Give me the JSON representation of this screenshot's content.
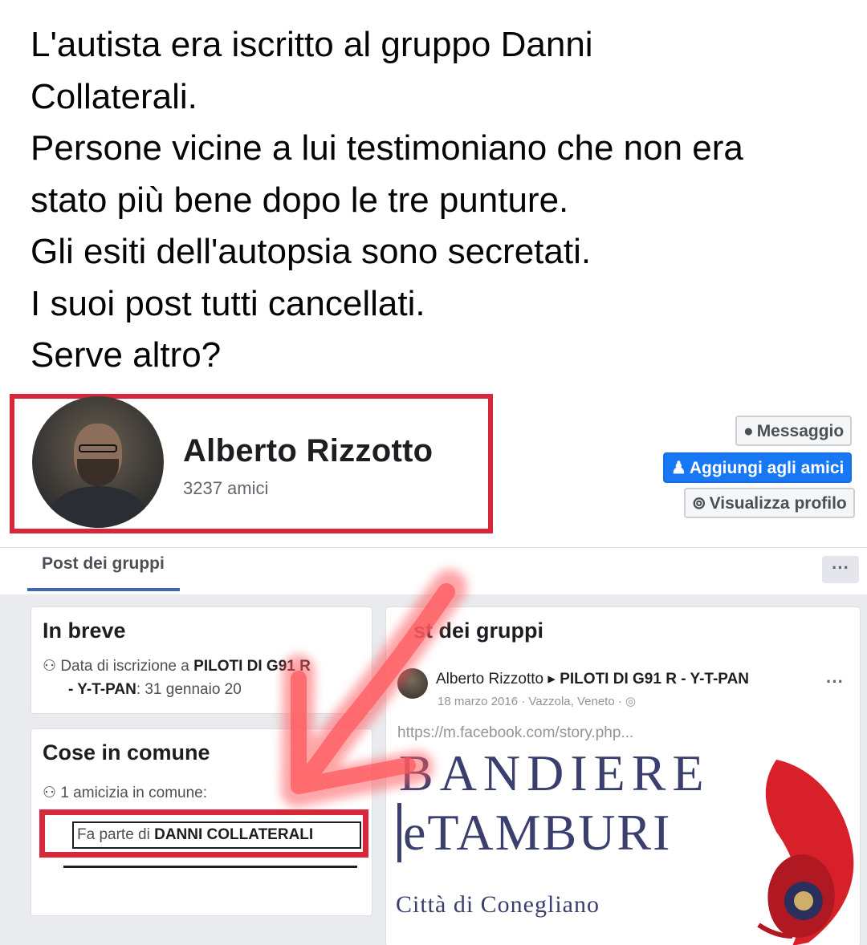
{
  "post": {
    "lines": [
      "L'autista era iscritto al gruppo Danni",
      "Collaterali.",
      "Persone vicine a lui testimoniano che non era",
      "stato più bene dopo le tre punture.",
      "Gli esiti dell'autopsia sono secretati.",
      "I suoi post tutti cancellati.",
      "Serve altro?"
    ]
  },
  "profile": {
    "name": "Alberto Rizzotto",
    "friends": "3237 amici",
    "buttons": {
      "message": "Messaggio",
      "add_friend": "Aggiungi agli amici",
      "view_profile": "Visualizza profilo"
    }
  },
  "tabs": {
    "active": "Post dei gruppi",
    "more": "···"
  },
  "brief": {
    "title": "In breve",
    "join_prefix": "Data di iscrizione a",
    "group": "PILOTI DI G91 R",
    "group_cont": "- Y-T-PAN",
    "date": ": 31 gennaio 20"
  },
  "common": {
    "title": "Cose in comune",
    "mutual": "1 amicizia in comune:",
    "member_prefix": "Fa parte di",
    "member_group": "DANNI COLLATERALI"
  },
  "group_posts": {
    "title": "st dei gruppi",
    "author": "Alberto Rizzotto",
    "separator": "▸",
    "group": "PILOTI DI G91 R - Y-T-PAN",
    "date": "18 marzo 2016 · Vazzola, Veneto ·",
    "link": "https://m.facebook.com/story.php...",
    "image_line1": "BANDIERE",
    "image_line2": "eTAMBURI",
    "image_line3": "Città di Conegliano"
  },
  "colors": {
    "highlight_red": "#d8263a",
    "facebook_blue": "#1877f2",
    "arrow_red": "#ff5a5f"
  }
}
